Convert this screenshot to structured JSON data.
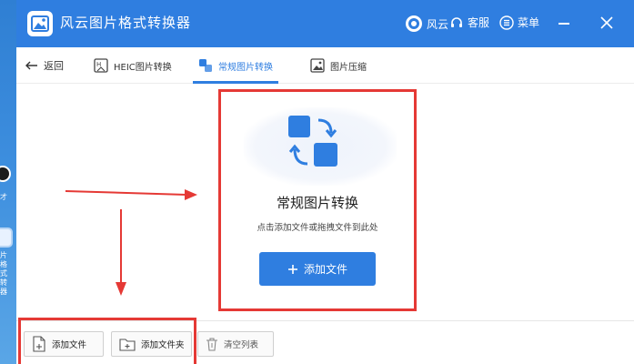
{
  "app": {
    "title": "风云图片格式转换器",
    "fengyun_label": "风云",
    "kefu_label": "客服",
    "menu_label": "菜单",
    "accent": "#2f7ee0"
  },
  "desktop": {
    "icon1_label": "才",
    "icon2_label": "片格式转 器"
  },
  "nav": {
    "back_label": "返回",
    "tabs": [
      {
        "label": "HEIC图片转换",
        "icon": "heic-icon",
        "active": false
      },
      {
        "label": "常规图片转换",
        "icon": "convert-icon",
        "active": true
      },
      {
        "label": "图片压缩",
        "icon": "image-compress-icon",
        "active": false
      }
    ]
  },
  "drop": {
    "title": "常规图片转换",
    "hint": "点击添加文件或拖拽文件到此处",
    "add_button_label": "添加文件"
  },
  "toolbar": {
    "add_file_label": "添加文件",
    "add_folder_label": "添加文件夹",
    "clear_list_label": "清空列表"
  },
  "annotation_color": "#e53935"
}
